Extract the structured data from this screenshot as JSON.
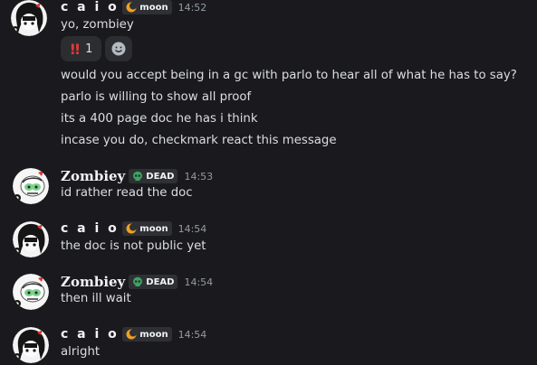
{
  "messages": [
    {
      "author": "c a i o",
      "tag": "moon",
      "time": "14:52",
      "lines": [
        "yo, zombiey"
      ],
      "reactions": [
        {
          "emoji": "!!",
          "count": "1"
        }
      ]
    },
    {
      "lines": [
        "would you accept being in a gc with parlo to hear all of what he has to say?",
        "parlo is willing to show all proof",
        "its a 400 page doc he has i think",
        "incase you do, checkmark react this message"
      ]
    },
    {
      "author": "Zombiey",
      "tag": "DEAD",
      "time": "14:53",
      "lines": [
        "id rather read the doc"
      ]
    },
    {
      "author": "c a i o",
      "tag": "moon",
      "time": "14:54",
      "lines": [
        "the doc is not public yet"
      ]
    },
    {
      "author": "Zombiey",
      "tag": "DEAD",
      "time": "14:54",
      "lines": [
        "then ill wait"
      ]
    },
    {
      "author": "c a i o",
      "tag": "moon",
      "time": "14:54",
      "lines": [
        "alright"
      ]
    }
  ],
  "colors": {
    "background": "#1a1a1e",
    "moon_icon": "#f0a020",
    "dead_icon": "#3ba55d",
    "reaction_red": "#e03a3a"
  },
  "icons": {
    "moon": "moon-icon",
    "dead": "skull-icon",
    "add_reaction": "smiley-icon"
  }
}
